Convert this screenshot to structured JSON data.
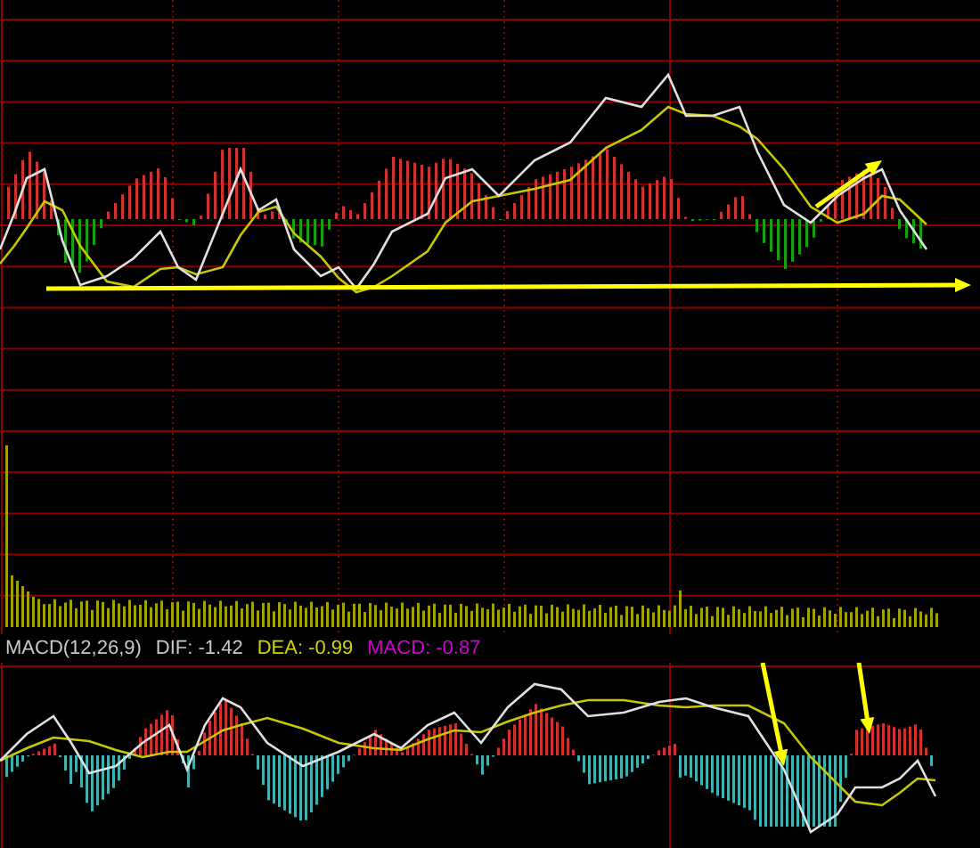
{
  "macd_legend": [
    {
      "text": "MACD(12,26,9)",
      "color": "#c8c8c8"
    },
    {
      "text": "DIF: -1.42",
      "color": "#c8c8c8"
    },
    {
      "text": "DEA: -0.99",
      "color": "#d2d200"
    },
    {
      "text": "MACD: -0.87",
      "color": "#d200d2"
    }
  ]
}
